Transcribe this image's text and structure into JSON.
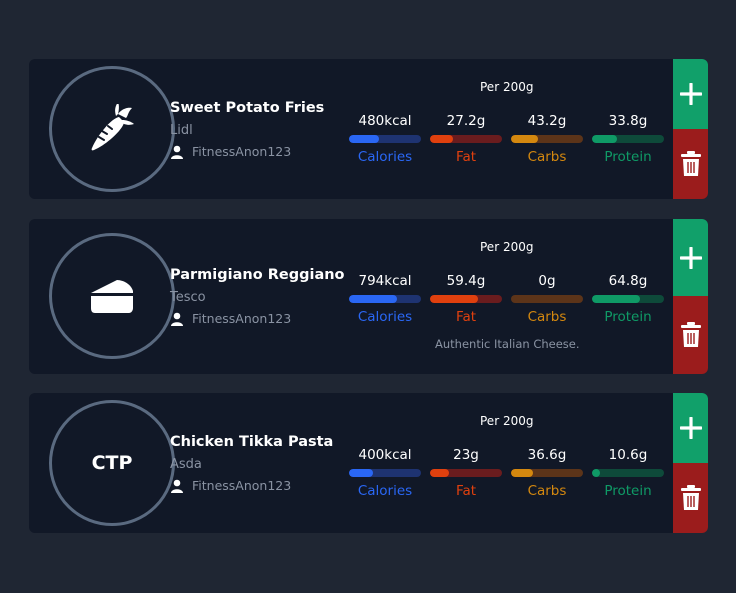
{
  "colors": {
    "background": "#1f2633",
    "card": "#111827",
    "calories": "#2a67f4",
    "fat": "#e0400e",
    "carbs": "#d4880f",
    "protein": "#0f9a66",
    "add": "#11a06a",
    "delete": "#9b1c1c"
  },
  "cards": [
    {
      "avatar": {
        "type": "icon",
        "icon": "carrot-icon"
      },
      "name": "Sweet Potato Fries",
      "brand": "Lidl",
      "user": "FitnessAnon123",
      "per": "Per 200g",
      "macros": {
        "calories": {
          "value": "480kcal",
          "label": "Calories",
          "fill": 0.42
        },
        "fat": {
          "value": "27.2g",
          "label": "Fat",
          "fill": 0.32
        },
        "carbs": {
          "value": "43.2g",
          "label": "Carbs",
          "fill": 0.38
        },
        "protein": {
          "value": "33.8g",
          "label": "Protein",
          "fill": 0.35
        }
      },
      "description": ""
    },
    {
      "avatar": {
        "type": "icon",
        "icon": "cheese-icon"
      },
      "name": "Parmigiano Reggiano",
      "brand": "Tesco",
      "user": "FitnessAnon123",
      "per": "Per 200g",
      "macros": {
        "calories": {
          "value": "794kcal",
          "label": "Calories",
          "fill": 0.66
        },
        "fat": {
          "value": "59.4g",
          "label": "Fat",
          "fill": 0.67
        },
        "carbs": {
          "value": "0g",
          "label": "Carbs",
          "fill": 0.0
        },
        "protein": {
          "value": "64.8g",
          "label": "Protein",
          "fill": 0.67
        }
      },
      "description": "Authentic Italian Cheese."
    },
    {
      "avatar": {
        "type": "text",
        "text": "CTP"
      },
      "name": "Chicken Tikka Pasta",
      "brand": "Asda",
      "user": "FitnessAnon123",
      "per": "Per 200g",
      "macros": {
        "calories": {
          "value": "400kcal",
          "label": "Calories",
          "fill": 0.33
        },
        "fat": {
          "value": "23g",
          "label": "Fat",
          "fill": 0.27
        },
        "carbs": {
          "value": "36.6g",
          "label": "Carbs",
          "fill": 0.31
        },
        "protein": {
          "value": "10.6g",
          "label": "Protein",
          "fill": 0.11
        }
      },
      "description": ""
    }
  ]
}
